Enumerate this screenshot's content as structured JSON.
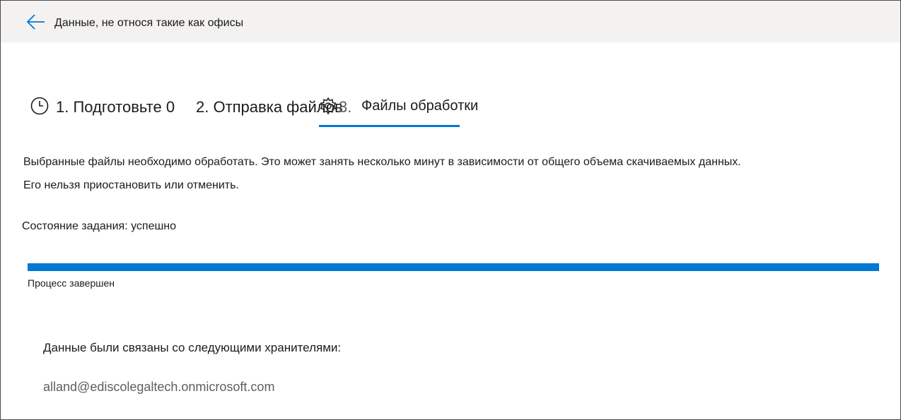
{
  "header": {
    "back_icon": "arrow-left-icon",
    "title": "Данные, не относя такие как офисы"
  },
  "steps": {
    "step1": {
      "icon": "clock-icon",
      "label": "1. Подготовьте 0"
    },
    "step2": {
      "label": "2. Отправка файлов"
    },
    "step3": {
      "icon": "gear-icon",
      "number": "3.",
      "label": "Файлы обработки"
    },
    "accent_color": "#0078d4"
  },
  "main": {
    "description_line1": "Выбранные файлы необходимо обработать. Это может занять несколько минут в зависимости от общего объема скачиваемых данных.",
    "description_line2": "Его нельзя приостановить или отменить.",
    "job_status": "Состояние задания: успешно",
    "progress": {
      "percent": 100,
      "label": "Процесс завершен"
    },
    "custodians_heading": "Данные были связаны со следующими хранителями:",
    "custodians": [
      "alland@ediscolegaltech.onmicrosoft.com"
    ]
  }
}
